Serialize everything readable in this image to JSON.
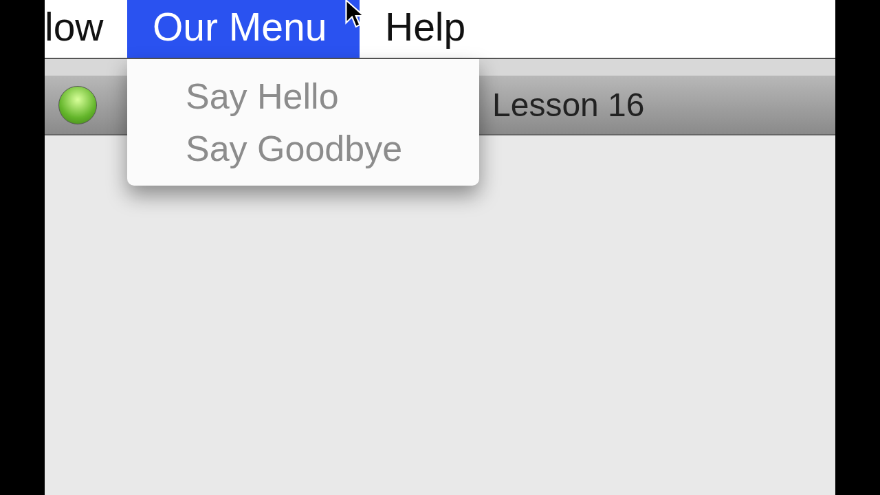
{
  "menu_bar": {
    "items": [
      {
        "label": "low",
        "selected": false
      },
      {
        "label": "Our Menu",
        "selected": true
      },
      {
        "label": "Help",
        "selected": false
      }
    ]
  },
  "dropdown": {
    "items": [
      {
        "label": "Say Hello",
        "disabled": true
      },
      {
        "label": "Say Goodbye",
        "disabled": true
      }
    ]
  },
  "window": {
    "title": "Lesson 16"
  }
}
